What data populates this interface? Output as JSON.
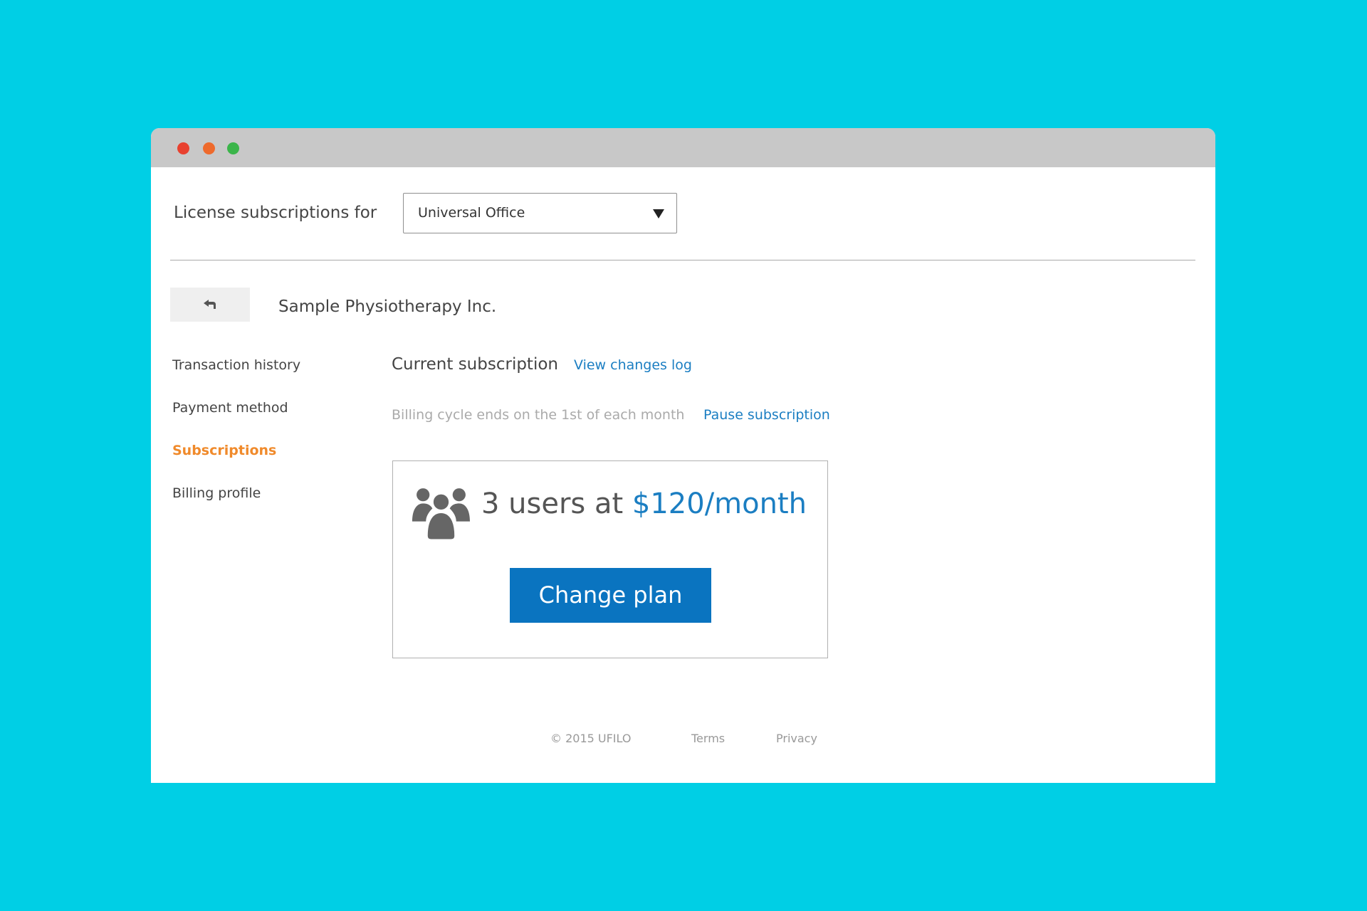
{
  "colors": {
    "background": "#00cfe5",
    "titlebar": "#c8c8c8",
    "link_blue": "#1b7ec2",
    "active_orange": "#f08a2b",
    "button_blue": "#0a74c0"
  },
  "window": {
    "controls": [
      {
        "icon": "close-dot-icon",
        "color": "#e8412f"
      },
      {
        "icon": "minimize-dot-icon",
        "color": "#ee6a2c"
      },
      {
        "icon": "maximize-dot-icon",
        "color": "#3bb54a"
      }
    ]
  },
  "header": {
    "label": "License subscriptions for",
    "product_select": {
      "value": "Universal Office",
      "icon": "dropdown-arrow-icon"
    }
  },
  "account": {
    "back_icon": "back-arrow-icon",
    "name": "Sample Physiotherapy Inc."
  },
  "sidebar": {
    "items": [
      {
        "label": "Transaction history",
        "active": false
      },
      {
        "label": "Payment method",
        "active": false
      },
      {
        "label": "Subscriptions",
        "active": true
      },
      {
        "label": "Billing profile",
        "active": false
      }
    ]
  },
  "subscription": {
    "title": "Current subscription",
    "changes_log_link": "View changes log",
    "billing_note": "Billing cycle ends on the 1st of each month",
    "pause_link": "Pause subscription",
    "plan": {
      "icon": "users-icon",
      "users_text": "3 users at",
      "price": "$120/month",
      "change_plan_button": "Change plan"
    }
  },
  "footer": {
    "copyright": "© 2015 UFILO",
    "links": [
      {
        "label": "Terms"
      },
      {
        "label": "Privacy"
      }
    ]
  }
}
